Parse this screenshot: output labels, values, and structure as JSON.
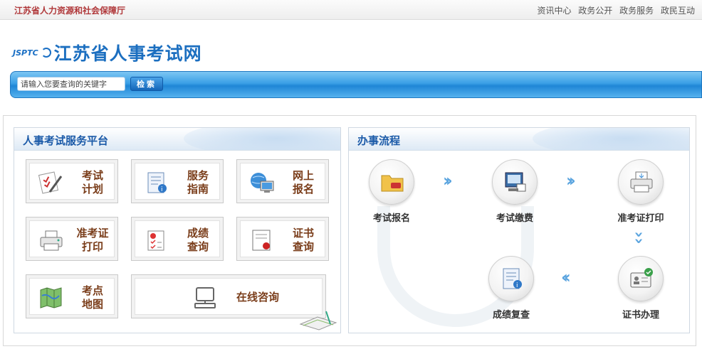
{
  "topbar": {
    "org_name": "江苏省人力资源和社会保障厅",
    "nav": [
      "资讯中心",
      "政务公开",
      "政务服务",
      "政民互动"
    ]
  },
  "logo": {
    "mark": "JSPTC",
    "title": "江苏省人事考试网"
  },
  "search": {
    "placeholder": "请输入您要查询的关键字",
    "value": "请输入您要查询的关键字",
    "button": "检索"
  },
  "left_panel": {
    "title": "人事考试服务平台",
    "tiles": [
      {
        "label": "考试\n计划",
        "icon": "exam-plan-icon"
      },
      {
        "label": "服务\n指南",
        "icon": "service-guide-icon"
      },
      {
        "label": "网上\n报名",
        "icon": "online-register-icon"
      },
      {
        "label": "准考证\n打印",
        "icon": "printer-icon"
      },
      {
        "label": "成绩\n查询",
        "icon": "score-query-icon"
      },
      {
        "label": "证书\n查询",
        "icon": "certificate-icon"
      },
      {
        "label": "考点\n地图",
        "icon": "map-icon"
      },
      {
        "label": "在线咨询",
        "icon": "computer-icon"
      }
    ]
  },
  "right_panel": {
    "title": "办事流程",
    "steps": [
      {
        "label": "考试报名",
        "icon": "folder-icon"
      },
      {
        "label": "考试缴费",
        "icon": "payment-icon"
      },
      {
        "label": "准考证打印",
        "icon": "printer-icon"
      },
      {
        "label": "证书办理",
        "icon": "id-card-icon"
      },
      {
        "label": "成绩复查",
        "icon": "report-icon"
      }
    ]
  },
  "colors": {
    "accent_blue": "#1c6fc0",
    "tile_text": "#7a3d1a",
    "org_red": "#b0383a"
  }
}
